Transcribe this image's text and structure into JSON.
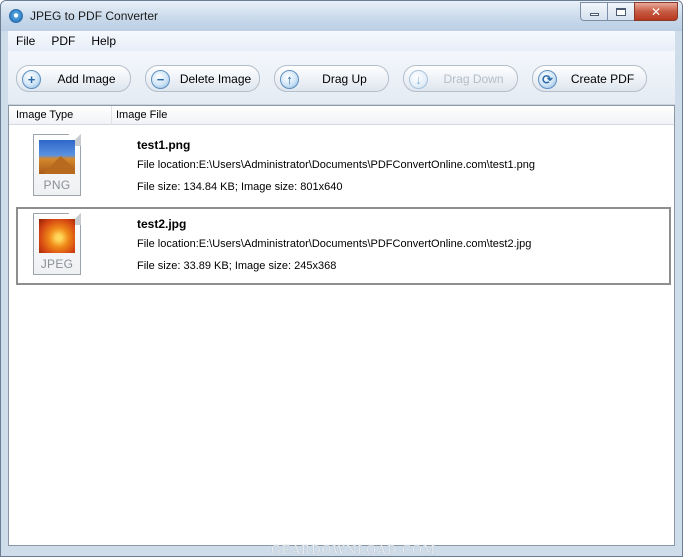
{
  "window": {
    "title": "JPEG to PDF Converter",
    "controls": {
      "minimize": "",
      "maximize": "",
      "close": "✕"
    }
  },
  "menu": {
    "items": [
      "File",
      "PDF",
      "Help"
    ]
  },
  "toolbar": {
    "add_image": "Add Image",
    "delete_image": "Delete Image",
    "drag_up": "Drag Up",
    "drag_down": "Drag Down",
    "create_pdf": "Create PDF",
    "drag_down_enabled": false
  },
  "list": {
    "columns": [
      "Image Type",
      "Image File"
    ],
    "files": [
      {
        "type_label": "PNG",
        "name": "test1.png",
        "location": "File location:E:\\Users\\Administrator\\Documents\\PDFConvertOnline.com\\test1.png",
        "size_line": "File size: 134.84 KB;  Image size: 801x640",
        "selected": false
      },
      {
        "type_label": "JPEG",
        "name": "test2.jpg",
        "location": "File location:E:\\Users\\Administrator\\Documents\\PDFConvertOnline.com\\test2.jpg",
        "size_line": "File size: 33.89 KB;    Image size: 245x368",
        "selected": true
      }
    ]
  },
  "watermark": "GEARDOWNLOAD.COM",
  "colors": {
    "titlebar": "#c8d8ea",
    "selection_border": "#8e8e8e",
    "close_button": "#c75b43"
  }
}
